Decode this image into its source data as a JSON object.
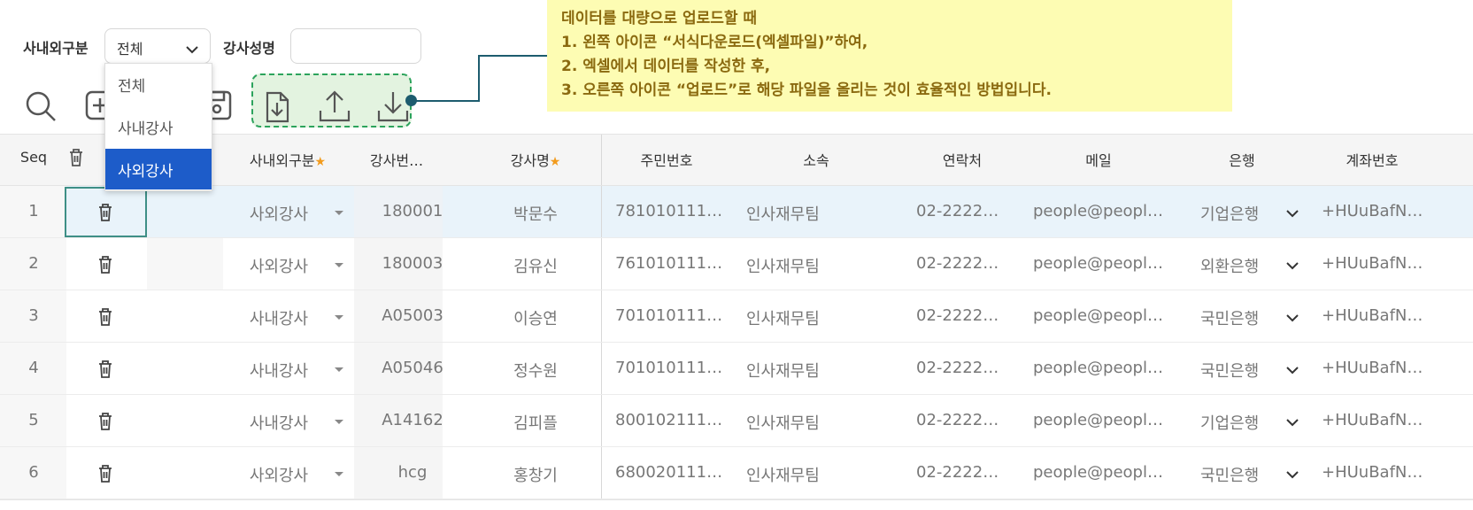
{
  "filters": {
    "type_label": "사내외구분",
    "type_value": "전체",
    "name_label": "강사성명",
    "name_value": ""
  },
  "dropdown": {
    "options": [
      "전체",
      "사내강사",
      "사외강사"
    ],
    "selected": "사외강사"
  },
  "toolbar": {
    "icons": [
      "search-icon",
      "add-icon",
      "save-icon",
      "template-download-icon",
      "upload-icon",
      "download-icon"
    ]
  },
  "callout": {
    "lines": [
      "데이터를 대량으로 업로드할 때",
      "1.  왼쪽 아이콘 “서식다운로드(엑셀파일)”하여,",
      "2.  엑셀에서 데이터를 작성한 후,",
      "3.  오른쪽 아이콘 “업로드”로 해당 파일을 올리는 것이 효율적인 방법입니다."
    ]
  },
  "grid": {
    "columns": {
      "seq": "Seq",
      "type": "사내외구분",
      "code": "강사번…",
      "name": "강사명",
      "rrn": "주민번호",
      "dept": "소속",
      "phone": "연락처",
      "email": "메일",
      "bank": "은행",
      "account": "계좌번호"
    },
    "rows": [
      {
        "seq": "1",
        "type": "사외강사",
        "code": "180001",
        "name": "박문수",
        "rrn": "781010111…",
        "dept": "인사재무팀",
        "phone": "02-2222…",
        "email": "people@peopl…",
        "bank": "기업은행",
        "account": "+HUuBafN…"
      },
      {
        "seq": "2",
        "type": "사외강사",
        "code": "180003",
        "name": "김유신",
        "rrn": "761010111…",
        "dept": "인사재무팀",
        "phone": "02-2222…",
        "email": "people@peopl…",
        "bank": "외환은행",
        "account": "+HUuBafN…"
      },
      {
        "seq": "3",
        "type": "사내강사",
        "code": "A05003",
        "name": "이승연",
        "rrn": "701010111…",
        "dept": "인사재무팀",
        "phone": "02-2222…",
        "email": "people@peopl…",
        "bank": "국민은행",
        "account": "+HUuBafN…"
      },
      {
        "seq": "4",
        "type": "사내강사",
        "code": "A05046",
        "name": "정수원",
        "rrn": "701010111…",
        "dept": "인사재무팀",
        "phone": "02-2222…",
        "email": "people@peopl…",
        "bank": "국민은행",
        "account": "+HUuBafN…"
      },
      {
        "seq": "5",
        "type": "사내강사",
        "code": "A14162",
        "name": "김피플",
        "rrn": "800102111…",
        "dept": "인사재무팀",
        "phone": "02-2222…",
        "email": "people@peopl…",
        "bank": "기업은행",
        "account": "+HUuBafN…"
      },
      {
        "seq": "6",
        "type": "사외강사",
        "code": "hcg",
        "name": "홍창기",
        "rrn": "680020111…",
        "dept": "인사재무팀",
        "phone": "02-2222…",
        "email": "people@peopl…",
        "bank": "국민은행",
        "account": "+HUuBafN…"
      }
    ]
  },
  "colors": {
    "accent": "#1d5cc9",
    "callout_bg": "#fdfcb3",
    "callout_text": "#8b6a10",
    "upload_group_border": "#2ca35c",
    "required_star": "#f29b1d"
  }
}
